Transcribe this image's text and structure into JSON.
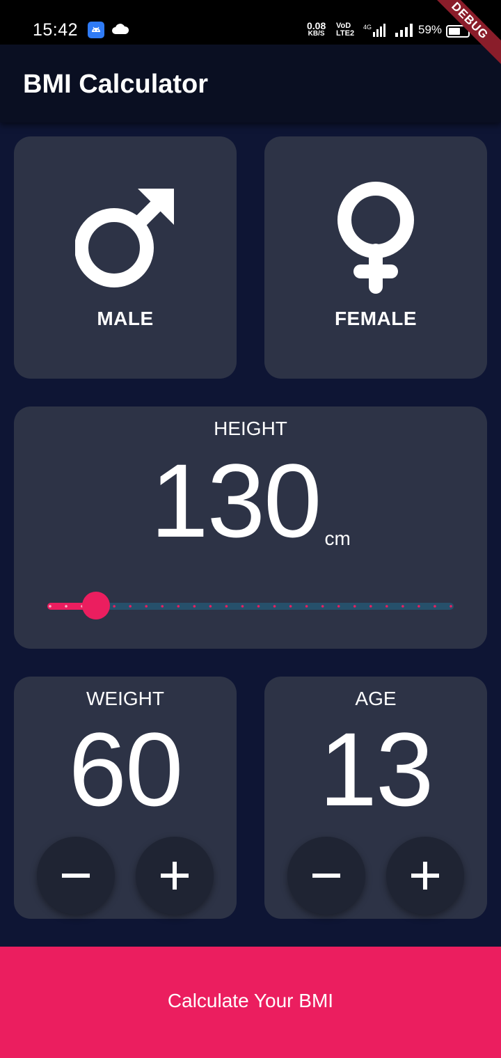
{
  "status_bar": {
    "time": "15:42",
    "net_speed": "0.08",
    "net_speed_unit": "KB/S",
    "volte_top": "VoD",
    "volte_bottom": "LTE2",
    "battery": "59%",
    "debug": "DEBUG"
  },
  "app_bar": {
    "title": "BMI Calculator"
  },
  "gender": {
    "male_label": "MALE",
    "female_label": "FEMALE"
  },
  "height": {
    "label": "HEIGHT",
    "value": "130",
    "unit": "cm",
    "slider_fraction": 0.12
  },
  "weight": {
    "label": "WEIGHT",
    "value": "60"
  },
  "age": {
    "label": "AGE",
    "value": "13"
  },
  "calculate_button": {
    "label": "Calculate Your BMI"
  },
  "colors": {
    "background": "#0e1534",
    "card": "#2d3346",
    "accent": "#eb1e5f",
    "app_bar": "#0a0f22",
    "round_button": "#1f2433"
  },
  "icons": {
    "male": "male-symbol-icon",
    "female": "female-symbol-icon",
    "minus": "minus-icon",
    "plus": "plus-icon"
  }
}
